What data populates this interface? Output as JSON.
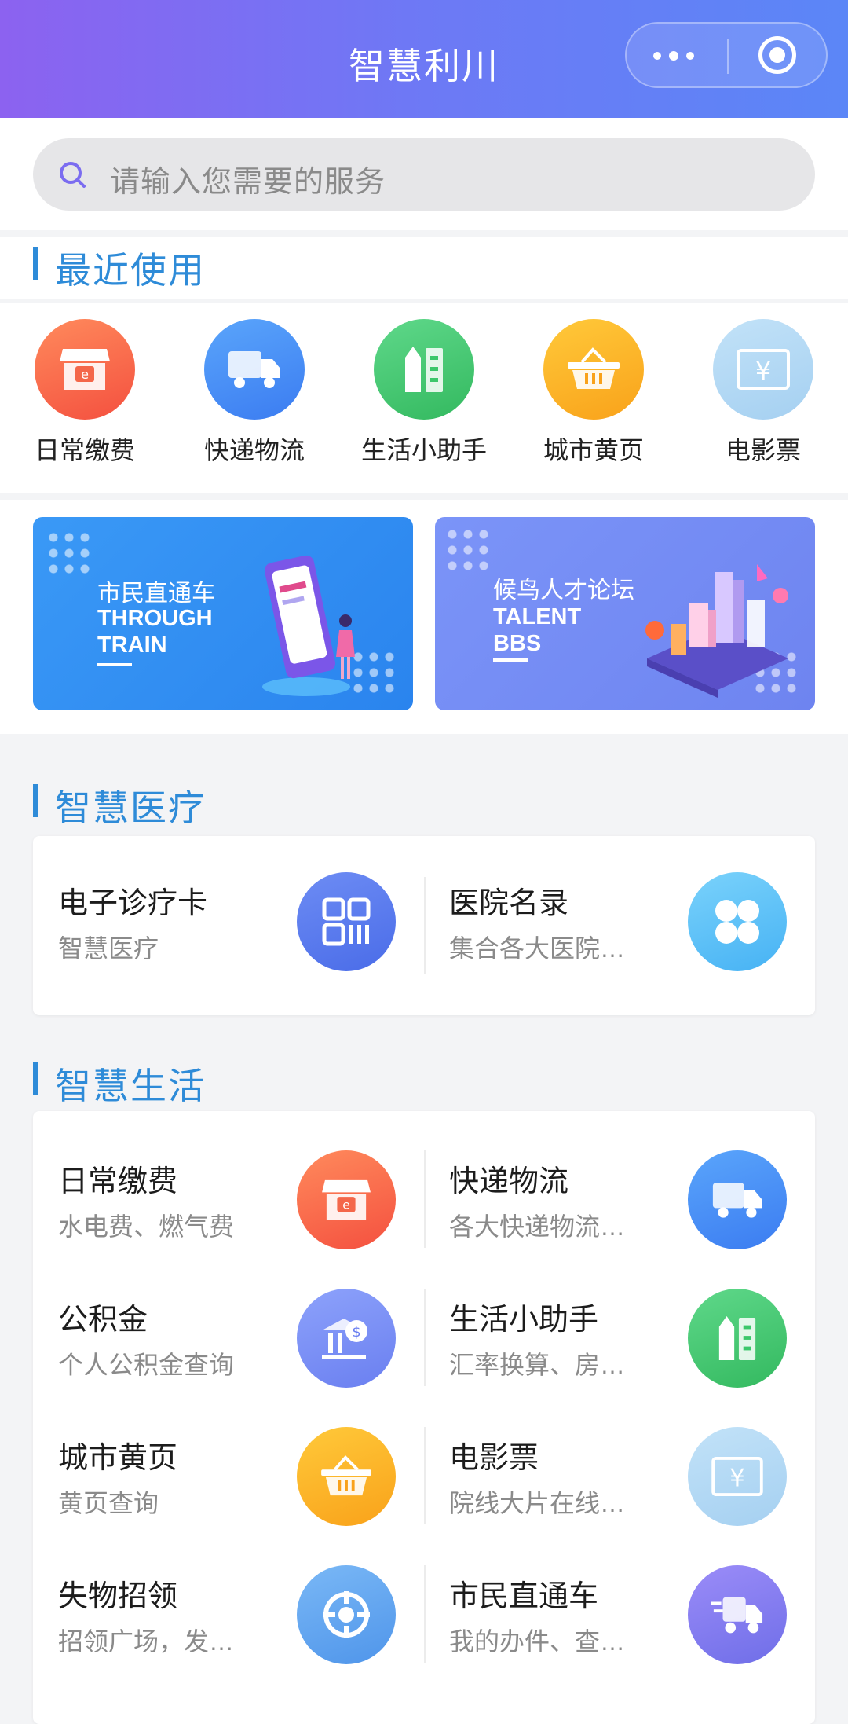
{
  "header": {
    "title": "智慧利川"
  },
  "search": {
    "placeholder": "请输入您需要的服务"
  },
  "recent": {
    "title": "最近使用",
    "items": [
      {
        "label": "日常缴费",
        "icon": "shop-icon",
        "color": "#f86a4c"
      },
      {
        "label": "快递物流",
        "icon": "truck-icon",
        "color": "#3f8cf3"
      },
      {
        "label": "生活小助手",
        "icon": "calculator-icon",
        "color": "#3cc76b"
      },
      {
        "label": "城市黄页",
        "icon": "basket-icon",
        "color": "#fbb124"
      },
      {
        "label": "电影票",
        "icon": "ticket-icon",
        "color": "#aad4f3"
      }
    ]
  },
  "banners": [
    {
      "cn": "市民直通车",
      "en1": "THROUGH",
      "en2": "TRAIN",
      "color": "#2f8ff2"
    },
    {
      "cn": "候鸟人才论坛",
      "en1": "TALENT",
      "en2": "BBS",
      "color": "#6e87f3"
    }
  ],
  "medical": {
    "title": "智慧医疗",
    "items": [
      {
        "title": "电子诊疗卡",
        "subtitle": "智慧医疗",
        "icon": "qrcode-icon"
      },
      {
        "title": "医院名录",
        "subtitle": "集合各大医院…",
        "icon": "clover-icon"
      }
    ]
  },
  "life": {
    "title": "智慧生活",
    "items": [
      {
        "title": "日常缴费",
        "subtitle": "水电费、燃气费",
        "icon": "shop-icon"
      },
      {
        "title": "快递物流",
        "subtitle": "各大快递物流…",
        "icon": "truck-icon"
      },
      {
        "title": "公积金",
        "subtitle": "个人公积金查询",
        "icon": "fund-icon"
      },
      {
        "title": "生活小助手",
        "subtitle": "汇率换算、房…",
        "icon": "calculator-icon"
      },
      {
        "title": "城市黄页",
        "subtitle": "黄页查询",
        "icon": "basket-icon"
      },
      {
        "title": "电影票",
        "subtitle": "院线大片在线…",
        "icon": "ticket-icon"
      },
      {
        "title": "失物招领",
        "subtitle": "招领广场，发…",
        "icon": "crosshair-icon"
      },
      {
        "title": "市民直通车",
        "subtitle": "我的办件、查…",
        "icon": "fast-truck-icon"
      }
    ]
  }
}
